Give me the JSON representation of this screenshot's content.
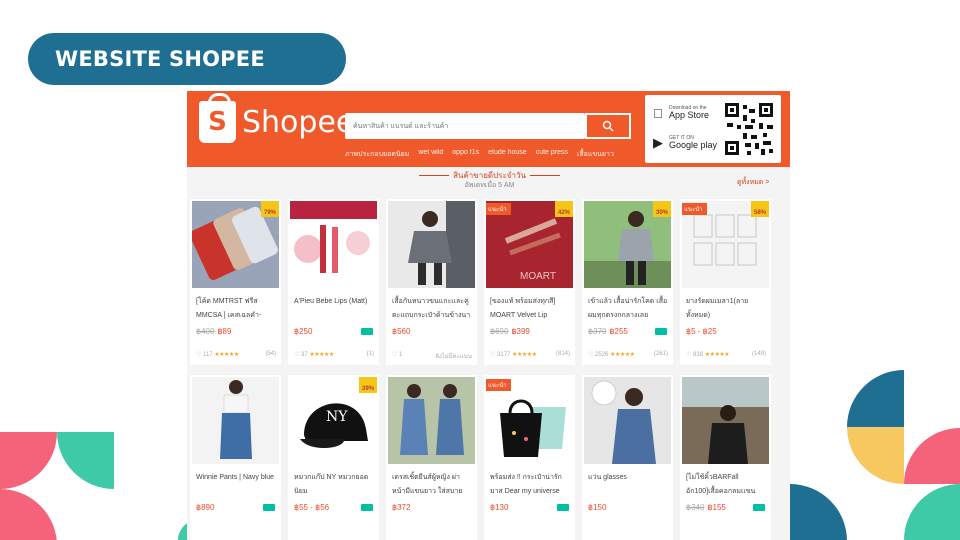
{
  "slide": {
    "title": "WEBSITE SHOPEE"
  },
  "colors": {
    "title_pill": "#1f6f93",
    "shopee_orange": "#f05a2a",
    "deco_teal": "#3ec9a7",
    "deco_pink": "#f4637a",
    "deco_yellow": "#f6c85f",
    "deco_blue": "#1f6f93"
  },
  "shopee": {
    "logo_icon_letter": "S",
    "logo_text": "Shopee",
    "search_placeholder": "ค้นหาสินค้า แบรนด์ และร้านค้า",
    "search_icon": "search-icon",
    "keywords": [
      "ภาพประกอบยอดนิยม",
      "wet wild",
      "oppo f1s",
      "etude house",
      "cute press",
      "เสื้อแขนยาว"
    ],
    "app_store_small": "Download on the",
    "app_store": "App Store",
    "google_play_small": "GET IT ON",
    "google_play": "Google play",
    "section_title": "สินค้าขายดีประจำวัน",
    "section_sub": "อัพเดทเมื่อ 5 AM",
    "see_all": "ดูทั้งหมด >"
  },
  "products_row1": [
    {
      "name": "[โค้ด MMTRST ฟรีส MMCSA ] เคสเฉลคำ-",
      "old_price": "฿400",
      "price": "฿89",
      "likes": "117",
      "reviews": "(54)",
      "badge": "79%",
      "pref": ""
    },
    {
      "name": "A'Pieu Bebe Lips (Matt)",
      "old_price": "",
      "price": "฿250",
      "likes": "37",
      "reviews": "(1)",
      "badge": "",
      "pref": ""
    },
    {
      "name": "เสื้อกันหนาวขนแกะเเละคู่ ตะแถบกระเป๋าด้านข้างนา",
      "old_price": "",
      "price": "฿560",
      "likes": "1",
      "reviews": "ยังไม่มีคะแนน",
      "badge": "",
      "pref": ""
    },
    {
      "name": "[ของแท้ พร้อมส่งทุกสี] MOART Velvet Lip",
      "old_price": "฿690",
      "price": "฿399",
      "likes": "3177",
      "reviews": "(814)",
      "badge": "42%",
      "pref": "แนะนำ"
    },
    {
      "name": "เข้าแล้ว เสื้อน่ารักโคด เสื้อผมทุกตรงกกลางเลย",
      "old_price": "฿370",
      "price": "฿255",
      "likes": "2526",
      "reviews": "(261)",
      "badge": "30%",
      "pref": ""
    },
    {
      "name": "ยางรัดผมเมลา1(ลาย ทั้งหมด)",
      "old_price": "",
      "price": "฿5 - ฿25",
      "likes": "838",
      "reviews": "(149)",
      "badge": "58%",
      "pref": "แนะนำ"
    }
  ],
  "products_row2": [
    {
      "name": "Winnie Pants | Navy blue",
      "old_price": "",
      "price": "฿890",
      "badge": "",
      "pref": ""
    },
    {
      "name": "หมวกแก๊ป NY หมวกยอดนิยม",
      "old_price": "",
      "price": "฿55 - ฿56",
      "badge": "39%",
      "pref": ""
    },
    {
      "name": "เดรสเชิ้ตยีนส์ผู้หญิง ผ่าหน้ามีแขนยาว ใส่สบาย แท้ชื่น",
      "old_price": "",
      "price": "฿372",
      "badge": "",
      "pref": ""
    },
    {
      "name": "พร้อมส่ง !! กระเป๋าน่ารัก มาส Dear my universe",
      "old_price": "",
      "price": "฿130",
      "badge": "",
      "pref": "แนะนำ"
    },
    {
      "name": "แว่น glasses",
      "old_price": "",
      "price": "฿150",
      "badge": "",
      "pref": ""
    },
    {
      "name": "[ไม่ใช้คิ้วBARFall อัก100]เสื้อคอกลมเเขน",
      "old_price": "฿340",
      "price": "฿155",
      "badge": "",
      "pref": ""
    }
  ]
}
